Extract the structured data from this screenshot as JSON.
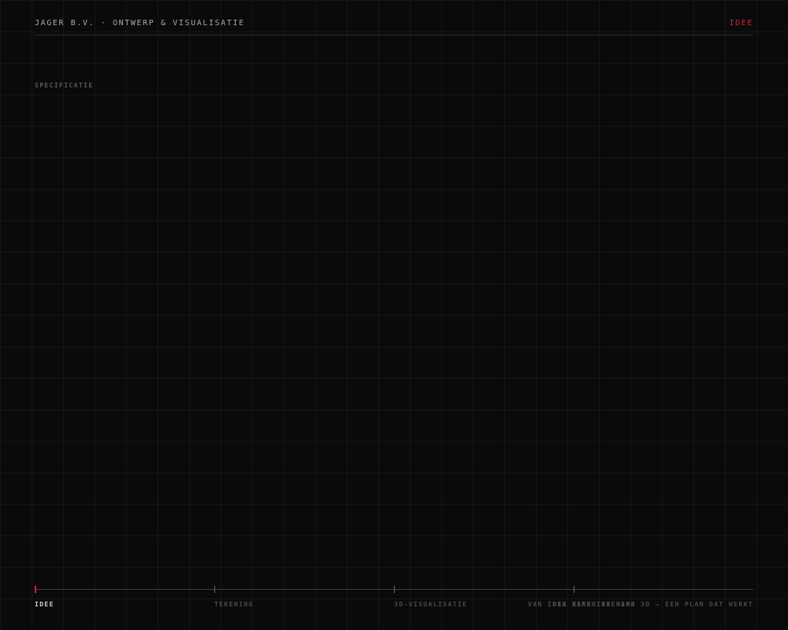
{
  "header": {
    "brand": "JAGER B.V. · ONTWERP & VISUALISATIE",
    "current_stage": "IDEE"
  },
  "section": {
    "label": "SPECIFICATIE"
  },
  "timeline": {
    "steps": [
      {
        "label": "IDEE",
        "active": true
      },
      {
        "label": "TEKENING",
        "active": false
      },
      {
        "label": "3D-VISUALISATIE",
        "active": false
      },
      {
        "label": "VAN IDEE NAAR TEKENING",
        "active": false
      }
    ],
    "tagline": "VAN TEKENING NAAR 3D — EEN PLAN DAT WERKT"
  },
  "colors": {
    "background": "#0a0a0a",
    "accent": "#d3242e",
    "text_muted": "#4a4a4a",
    "text_header": "#a8a8a8"
  }
}
